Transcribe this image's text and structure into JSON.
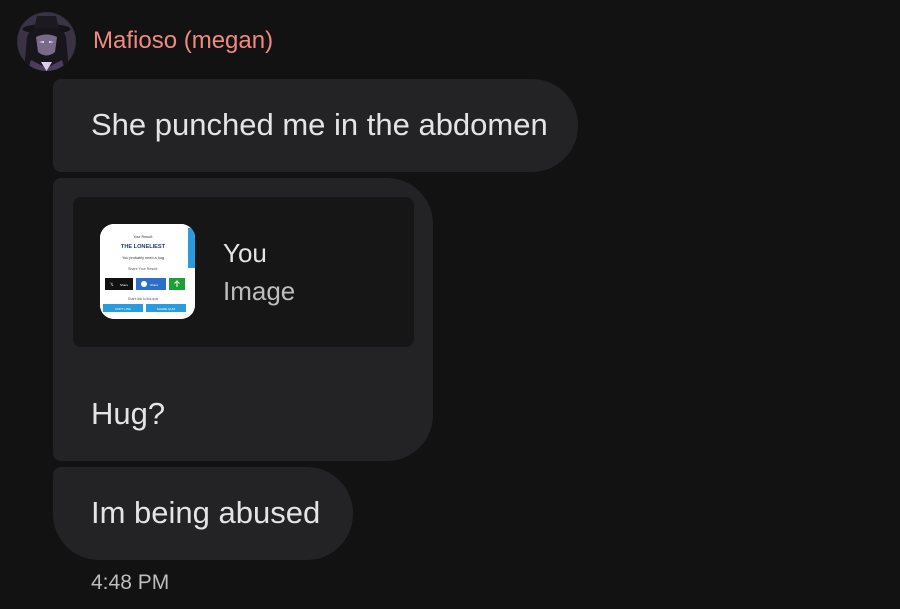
{
  "sender": {
    "name": "Mafioso (megan)",
    "name_color": "#f08a80",
    "avatar_icon": "avatar-hooded-figure"
  },
  "messages": [
    {
      "text": "She punched me in the abdomen"
    },
    {
      "reply": {
        "title": "You",
        "subtitle": "Image",
        "thumbnail": {
          "header": "Your Result:",
          "title": "THE LONELIEST",
          "subtitle": "You probably need a hug",
          "share_label": "Share Your Result:",
          "buttons": [
            "Share",
            "Share"
          ],
          "link_label": "Share link to this quiz",
          "copy_label": "COPY LINK",
          "share_quiz_label": "SHARE QUIZ"
        }
      },
      "text": "Hug?"
    },
    {
      "text": "Im being abused"
    }
  ],
  "timestamp": "4:48 PM",
  "colors": {
    "background": "#121212",
    "bubble": "#232325",
    "reply_card": "#161616",
    "text": "#e4e4e4",
    "muted_text": "#bdbdbd"
  }
}
